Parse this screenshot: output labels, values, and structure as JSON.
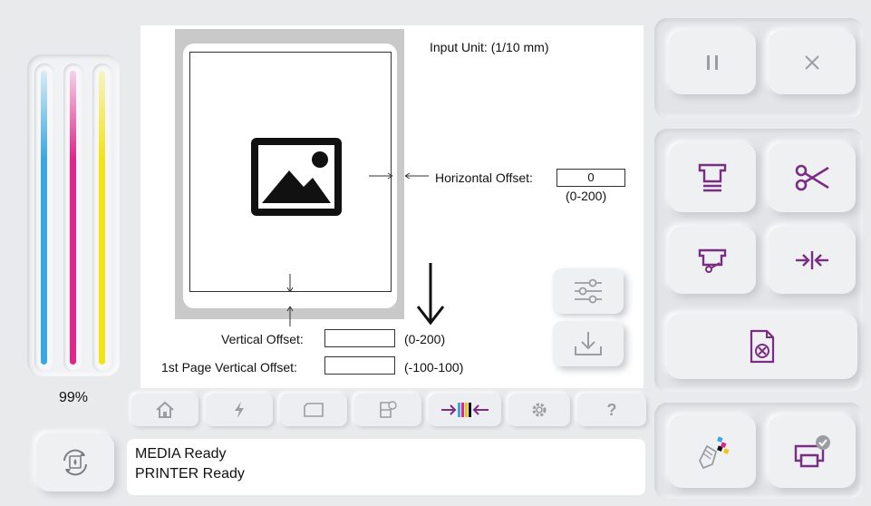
{
  "ink": {
    "level_label": "99%",
    "colors": {
      "cyan": "#3aa8e0",
      "magenta": "#e0268c",
      "yellow": "#f2e415"
    },
    "level": 0.99
  },
  "layout_settings": {
    "input_unit": "Input Unit: (1/10 mm)",
    "horizontal_offset": {
      "label": "Horizontal Offset:",
      "value": "0",
      "range": "(0-200)"
    },
    "vertical_offset": {
      "label": "Vertical Offset:",
      "value": "",
      "range": "(0-200)"
    },
    "first_page_vertical_offset": {
      "label": "1st Page Vertical Offset:",
      "value": "",
      "range": "(-100-100)"
    }
  },
  "status": {
    "line1": "MEDIA Ready",
    "line2": "PRINTER Ready"
  },
  "tabs": [
    {
      "icon": "home-icon"
    },
    {
      "icon": "lightning-icon"
    },
    {
      "icon": "media-icon"
    },
    {
      "icon": "printhead-icon"
    },
    {
      "icon": "calibration-icon"
    },
    {
      "icon": "gear-icon"
    },
    {
      "icon": "help-icon",
      "label": "?"
    }
  ],
  "accent_color": "#7b2d83"
}
